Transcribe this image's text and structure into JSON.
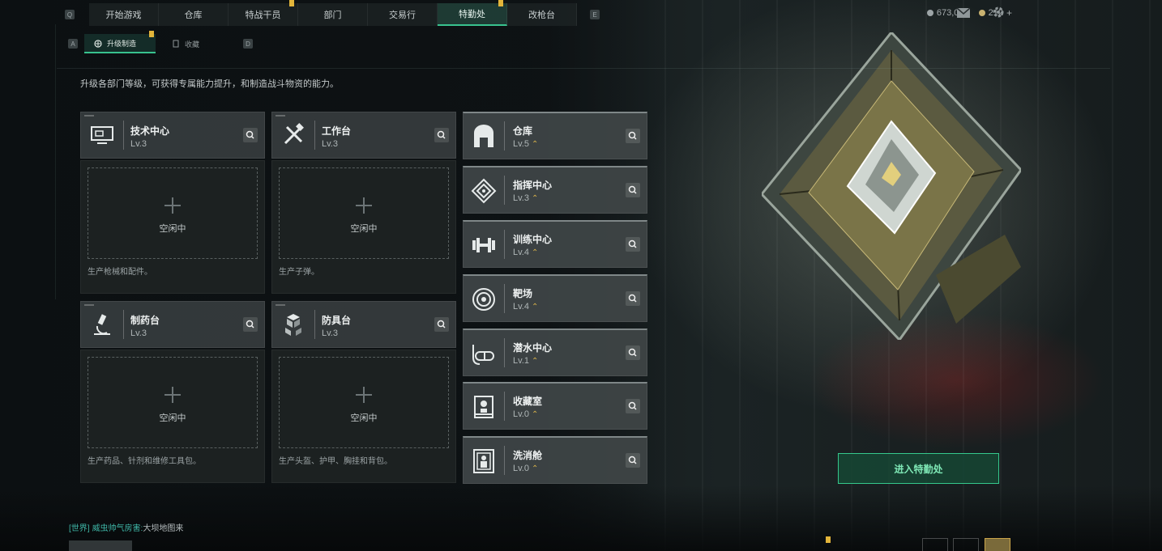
{
  "nav": {
    "left_key": "Q",
    "right_key": "E",
    "tabs": [
      {
        "label": "开始游戏",
        "active": false,
        "flag": false
      },
      {
        "label": "仓库",
        "active": false,
        "flag": false
      },
      {
        "label": "特战干员",
        "active": false,
        "flag": true
      },
      {
        "label": "部门",
        "active": false,
        "flag": false
      },
      {
        "label": "交易行",
        "active": false,
        "flag": false
      },
      {
        "label": "特勤处",
        "active": true,
        "flag": true
      },
      {
        "label": "改枪台",
        "active": false,
        "flag": false
      }
    ]
  },
  "subnav": {
    "left_key": "A",
    "right_key": "D",
    "tabs": [
      {
        "label": "升级制造",
        "active": true
      },
      {
        "label": "收藏",
        "active": false
      }
    ]
  },
  "resources": {
    "currency_a": "673,054",
    "currency_b": "212",
    "plus": "+"
  },
  "description": "升级各部门等级，可获得专属能力提升，和制造战斗物资的能力。",
  "workshops": [
    {
      "name": "技术中心",
      "level": "Lv.3",
      "icon": "computer-icon",
      "slot": "空闲中",
      "slot_desc": "生产枪械和配件。"
    },
    {
      "name": "工作台",
      "level": "Lv.3",
      "icon": "tools-icon",
      "slot": "空闲中",
      "slot_desc": "生产子弹。"
    },
    {
      "name": "制药台",
      "level": "Lv.3",
      "icon": "microscope-icon",
      "slot": "空闲中",
      "slot_desc": "生产药品、针剂和维修工具包。"
    },
    {
      "name": "防具台",
      "level": "Lv.3",
      "icon": "boxes-icon",
      "slot": "空闲中",
      "slot_desc": "生产头盔、护甲、胸挂和背包。"
    }
  ],
  "facilities": [
    {
      "name": "仓库",
      "level": "Lv.5",
      "icon": "warehouse-icon"
    },
    {
      "name": "指挥中心",
      "level": "Lv.3",
      "icon": "command-icon"
    },
    {
      "name": "训练中心",
      "level": "Lv.4",
      "icon": "dumbbell-icon"
    },
    {
      "name": "靶场",
      "level": "Lv.4",
      "icon": "target-icon"
    },
    {
      "name": "潜水中心",
      "level": "Lv.1",
      "icon": "diving-mask-icon"
    },
    {
      "name": "收藏室",
      "level": "Lv.0",
      "icon": "trophy-case-icon"
    },
    {
      "name": "洗消舱",
      "level": "Lv.0",
      "icon": "decon-chamber-icon"
    }
  ],
  "upgrade_mark": "⌃",
  "enter_button": "进入特勤处",
  "chat": {
    "channel": "[世界]",
    "sender": "威虫帅气房害:",
    "message": "大坝地图来"
  },
  "colors": {
    "accent": "#38c28e",
    "upgrade": "#d8b24a",
    "flag": "#e3b53a"
  }
}
